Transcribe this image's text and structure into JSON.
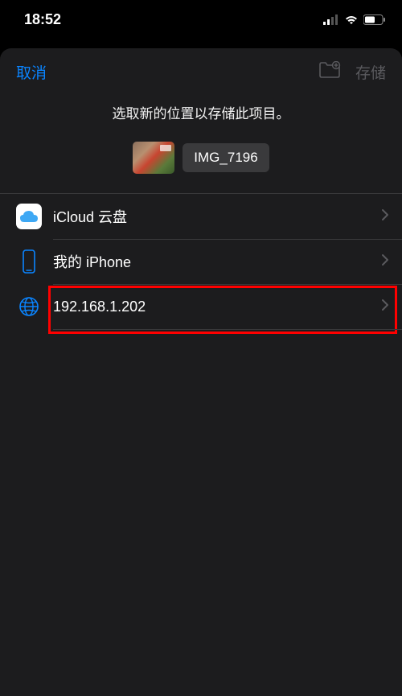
{
  "status_bar": {
    "time": "18:52"
  },
  "sheet": {
    "cancel_label": "取消",
    "save_label": "存储",
    "prompt": "选取新的位置以存储此项目。",
    "filename": "IMG_7196"
  },
  "locations": [
    {
      "label": "iCloud 云盘",
      "icon": "icloud"
    },
    {
      "label": "我的 iPhone",
      "icon": "iphone"
    },
    {
      "label": "192.168.1.202",
      "icon": "globe"
    }
  ]
}
